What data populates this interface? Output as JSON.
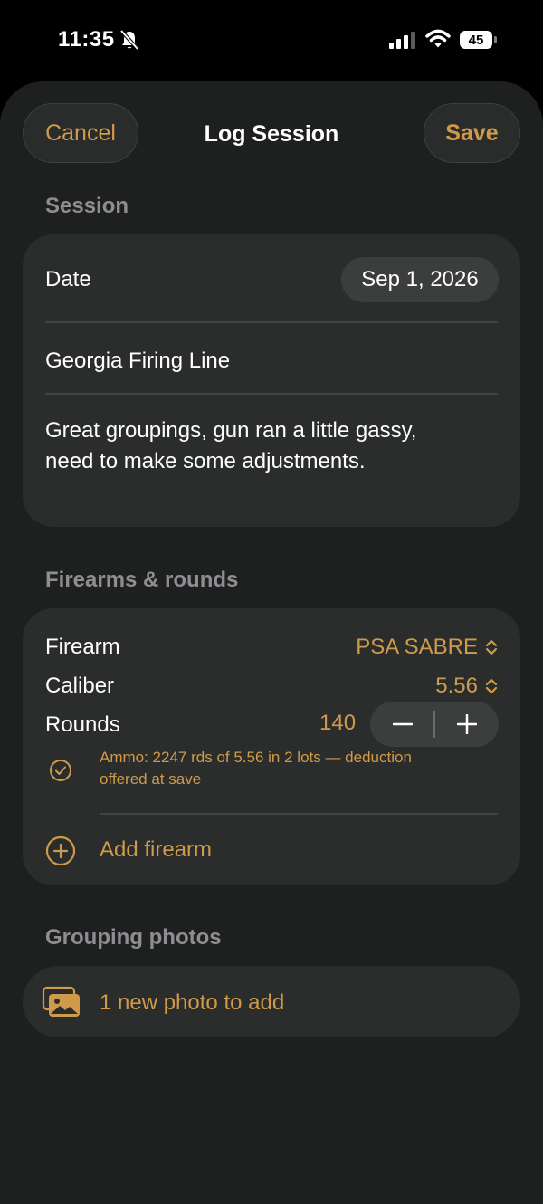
{
  "status_bar": {
    "time": "11:35",
    "battery": "45",
    "icons": [
      "bell-slash-icon",
      "cellular-signal-icon",
      "wifi-icon",
      "battery-icon"
    ]
  },
  "nav": {
    "cancel_label": "Cancel",
    "title": "Log Session",
    "save_label": "Save"
  },
  "session": {
    "header": "Session",
    "date_label": "Date",
    "date_value": "Sep 1, 2026",
    "location": "Georgia Firing Line",
    "notes_line1": "Great groupings, gun ran a little gassy,",
    "notes_line2": "need to make some adjustments."
  },
  "firearms": {
    "header": "Firearms & rounds",
    "firearm_label": "Firearm",
    "firearm_value": "PSA SABRE",
    "caliber_label": "Caliber",
    "caliber_value": "5.56",
    "rounds_label": "Rounds",
    "rounds_value": "140",
    "ammo_line1": "Ammo: 2247 rds of 5.56 in 2 lots — deduction",
    "ammo_line2": "offered at save",
    "add_firearm_label": "Add firearm"
  },
  "photos": {
    "header": "Grouping photos",
    "add_label": "1 new photo to add"
  },
  "colors": {
    "accent": "#cf9b4a",
    "background": "#1e1f1f",
    "card": "#2b2c2c",
    "secondary_text": "#8e8e92"
  }
}
